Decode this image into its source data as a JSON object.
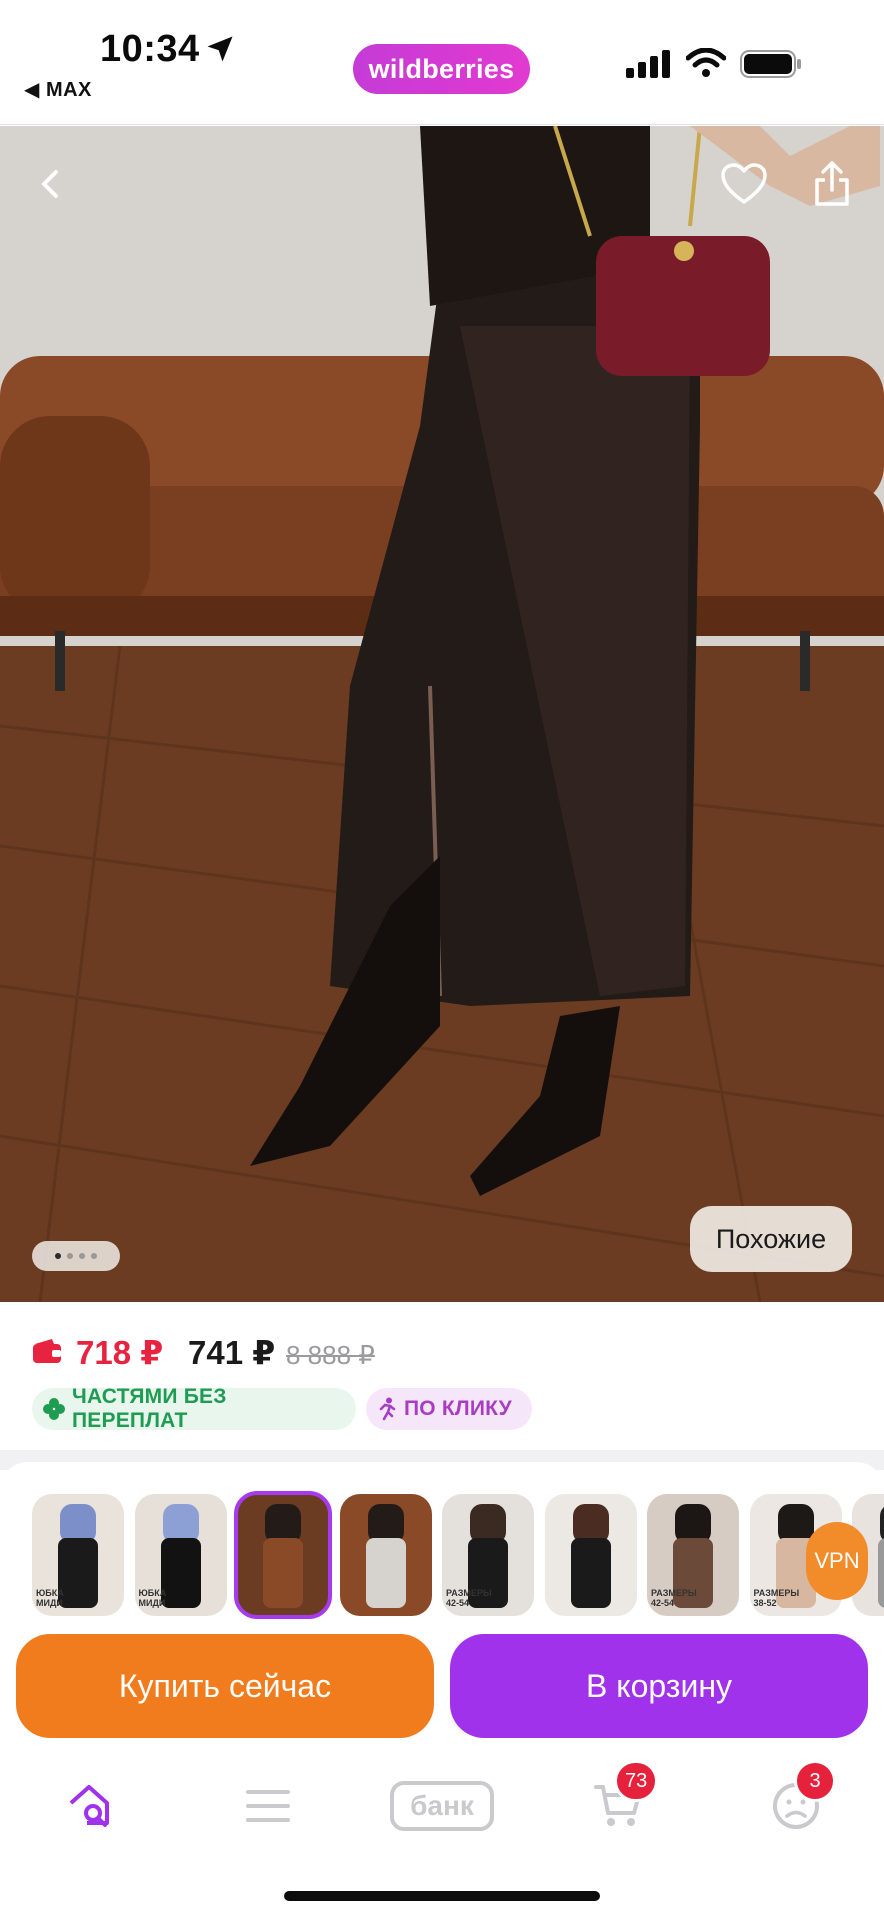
{
  "status_bar": {
    "time": "10:34",
    "back_app": "◀ MAX",
    "brand": "wildberries"
  },
  "hero": {
    "dots_count": 4,
    "active_dot": 0,
    "similar_label": "Похожие"
  },
  "price": {
    "wallet_price": "718 ₽",
    "main_price": "741 ₽",
    "old_price": "8 888 ₽",
    "colors": {
      "wallet": "#e8233f",
      "old": "#9a9a9f"
    }
  },
  "badges": {
    "parts": "ЧАСТЯМИ БЕЗ ПЕРЕПЛАТ",
    "click": "ПО КЛИКУ"
  },
  "thumbnails": {
    "selected_index": 2,
    "items": [
      {
        "caption": "ЮБКА МИДИ"
      },
      {
        "caption": "ЮБКА МИДИ"
      },
      {
        "caption": ""
      },
      {
        "caption": ""
      },
      {
        "caption": "РАЗМЕРЫ 42-54"
      },
      {
        "caption": ""
      },
      {
        "caption": "РАЗМЕРЫ 42-54"
      },
      {
        "caption": "РАЗМЕРЫ 38-52"
      },
      {
        "caption": ""
      }
    ]
  },
  "vpn_label": "VPN",
  "actions": {
    "buy_now": "Купить сейчас",
    "add_to_cart": "В корзину",
    "colors": {
      "buy_now": "#f07c1d",
      "add_to_cart": "#a132ec"
    }
  },
  "tabbar": {
    "bank_label": "банк",
    "cart_count": "73",
    "profile_count": "3",
    "active_color": "#a132ec",
    "inactive_color": "#c9c9ce"
  }
}
